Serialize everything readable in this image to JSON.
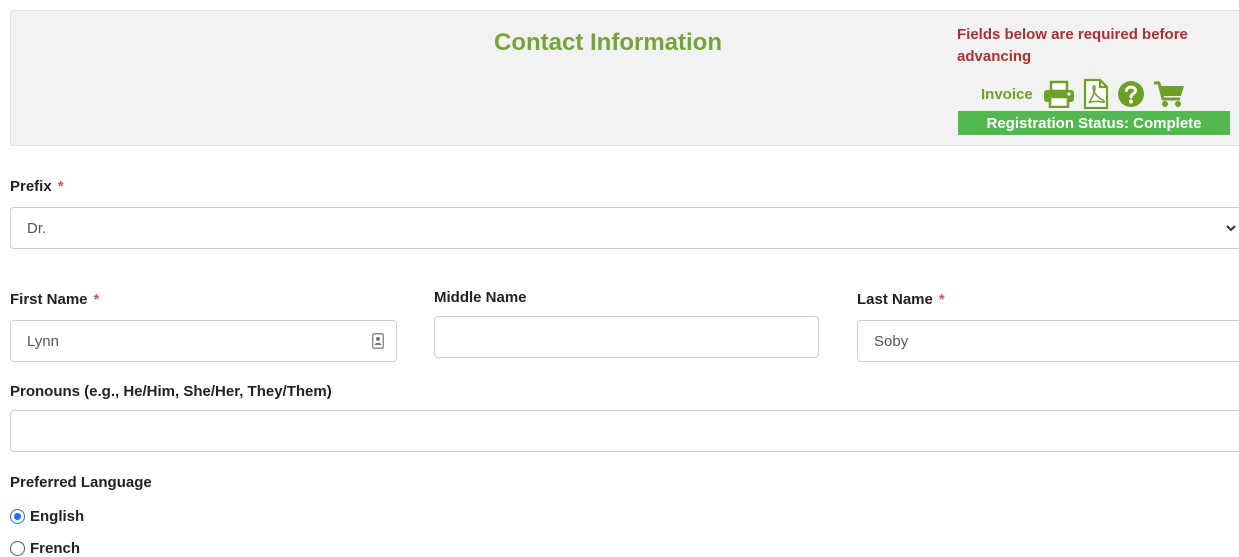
{
  "header": {
    "title": "Contact Information",
    "required_note": "Fields below are required before advancing",
    "invoice_label": "Invoice",
    "tools": [
      "printer-icon",
      "pdf-icon",
      "help-icon",
      "cart-icon"
    ],
    "status": "Registration Status: Complete",
    "colors": {
      "title": "#7aa23a",
      "note": "#a83232",
      "icons": "#6da026",
      "status_bg": "#53b84f"
    }
  },
  "form": {
    "prefix": {
      "label": "Prefix",
      "required": "*",
      "value": "Dr."
    },
    "first_name": {
      "label": "First Name",
      "required": "*",
      "value": "Lynn"
    },
    "middle_name": {
      "label": "Middle Name",
      "value": ""
    },
    "last_name": {
      "label": "Last Name",
      "required": "*",
      "value": "Soby"
    },
    "pronouns": {
      "label": "Pronouns (e.g., He/Him, She/Her, They/Them)",
      "value": ""
    },
    "language": {
      "label": "Preferred Language",
      "options": [
        {
          "label": "English",
          "checked": true
        },
        {
          "label": "French",
          "checked": false
        }
      ]
    }
  }
}
